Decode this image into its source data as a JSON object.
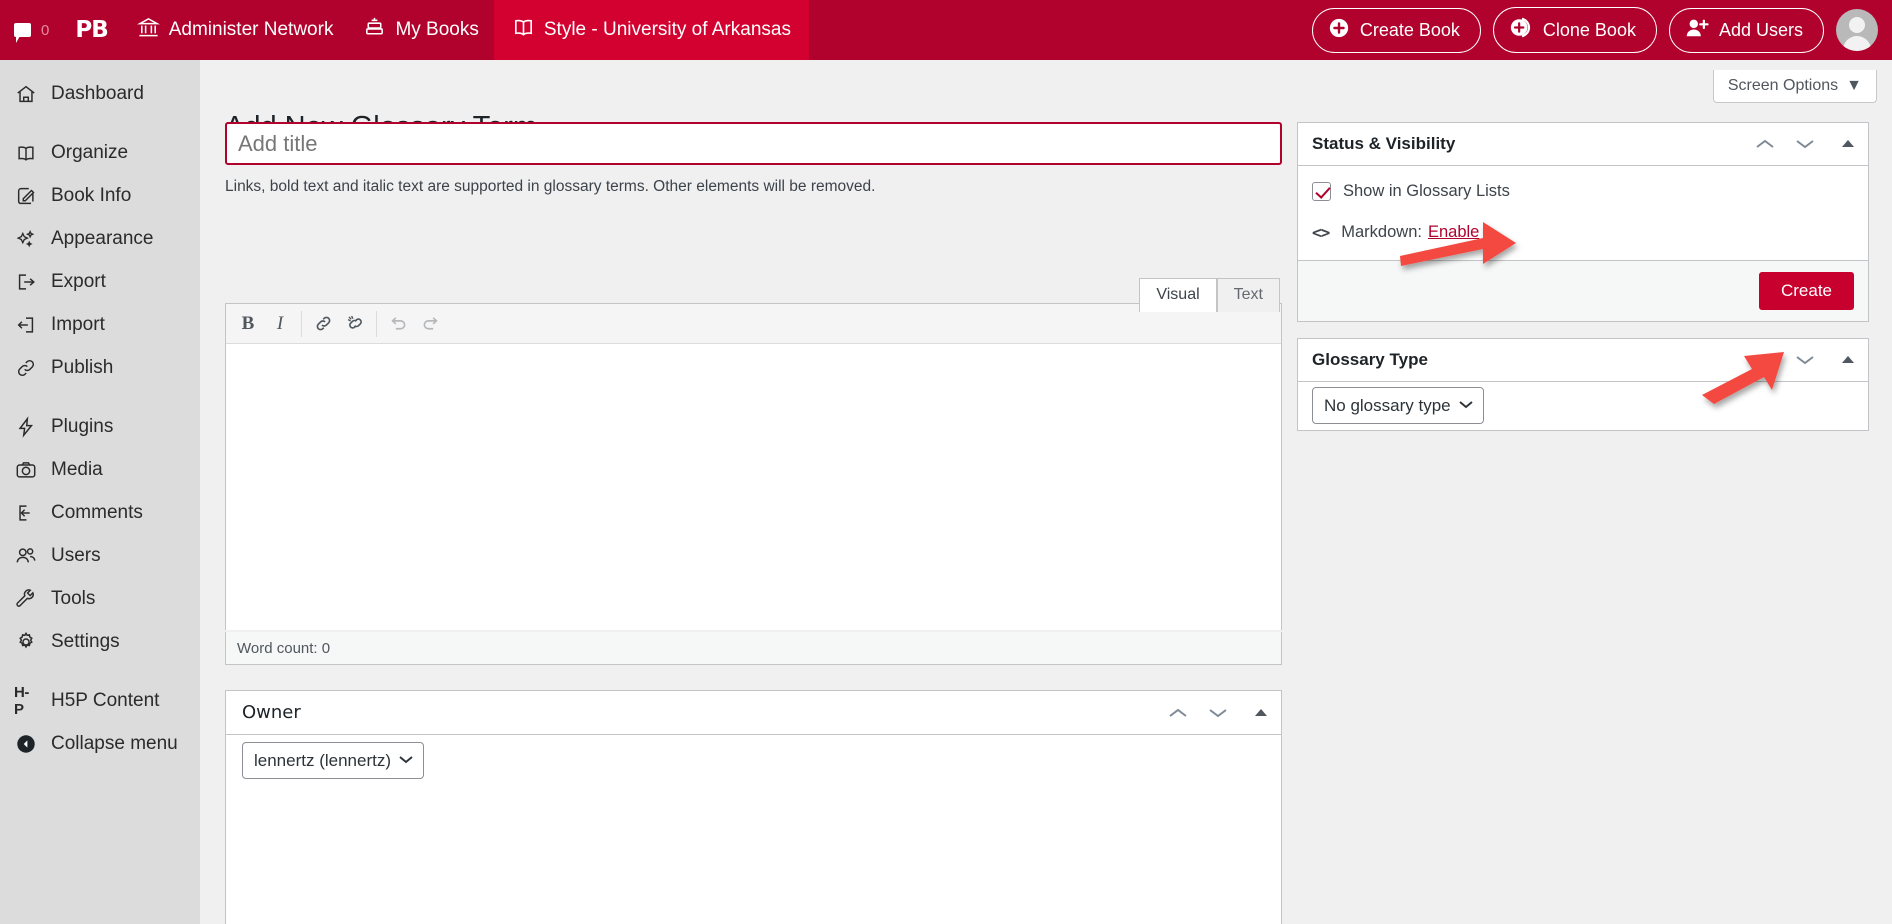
{
  "adminbar": {
    "comment_count": "0",
    "comment_icon": "comment-bubble-icon",
    "logo_text": "PB",
    "items": [
      {
        "label": "Administer Network",
        "icon": "bank-icon"
      },
      {
        "label": "My Books",
        "icon": "books-icon"
      },
      {
        "label": "Style - University of Arkansas",
        "icon": "open-book-icon"
      }
    ],
    "buttons": [
      {
        "label": "Create Book",
        "icon": "plus-circle-icon"
      },
      {
        "label": "Clone Book",
        "icon": "clone-circle-icon"
      },
      {
        "label": "Add Users",
        "icon": "user-plus-icon"
      }
    ],
    "avatar_alt": "User avatar",
    "bg_color": "#b0022c",
    "highlight_color": "#d2012f"
  },
  "sidebar": {
    "items": [
      {
        "label": "Dashboard",
        "icon": "home-icon"
      },
      {
        "label": "Organize",
        "icon": "open-book-icon"
      },
      {
        "label": "Book Info",
        "icon": "edit-square-icon"
      },
      {
        "label": "Appearance",
        "icon": "sparkles-icon"
      },
      {
        "label": "Export",
        "icon": "export-arrow-icon"
      },
      {
        "label": "Import",
        "icon": "import-arrow-icon"
      },
      {
        "label": "Publish",
        "icon": "link-chain-icon"
      },
      {
        "label": "Plugins",
        "icon": "plug-bolt-icon"
      },
      {
        "label": "Media",
        "icon": "camera-icon"
      },
      {
        "label": "Comments",
        "icon": "comment-icon"
      },
      {
        "label": "Users",
        "icon": "users-icon"
      },
      {
        "label": "Tools",
        "icon": "wrench-icon"
      },
      {
        "label": "Settings",
        "icon": "gear-icon"
      }
    ],
    "h5p": {
      "label": "H5P Content",
      "mark": "H-P",
      "icon": "h5p-icon"
    },
    "collapse": {
      "label": "Collapse menu",
      "icon": "collapse-left-icon"
    }
  },
  "screen_options": {
    "label": "Screen Options",
    "icon": "chevron-down-icon"
  },
  "page": {
    "title": "Add New Glossary Term",
    "title_input_placeholder": "Add title",
    "title_input_value": "",
    "help_text": "Links, bold text and italic text are supported in glossary terms. Other elements will be removed."
  },
  "editor": {
    "tabs": [
      {
        "label": "Visual",
        "active": true
      },
      {
        "label": "Text",
        "active": false
      }
    ],
    "toolbar": [
      {
        "name": "bold-button",
        "label": "B",
        "disabled": false
      },
      {
        "name": "italic-button",
        "label": "I",
        "disabled": false
      },
      {
        "name": "insert-link-button",
        "label": "",
        "disabled": false
      },
      {
        "name": "remove-link-button",
        "label": "",
        "disabled": false
      },
      {
        "name": "undo-button",
        "label": "",
        "disabled": true
      },
      {
        "name": "redo-button",
        "label": "",
        "disabled": true
      }
    ],
    "content": "",
    "word_count": "Word count: 0"
  },
  "owner_box": {
    "title": "Owner",
    "select_value": "lennertz (lennertz)"
  },
  "status_visibility": {
    "title": "Status & Visibility",
    "checkbox_label": "Show in Glossary Lists",
    "checkbox_checked": true,
    "markdown_label": "Markdown:",
    "markdown_link": "Enable",
    "markdown_icon": "code-brackets-icon",
    "create_button": "Create"
  },
  "glossary_type": {
    "title": "Glossary Type",
    "select_value": "No glossary type"
  },
  "annotations": {
    "arrow_color": "#f4483f",
    "arrow1_name": "arrow-to-show-in-glossary-lists",
    "arrow2_name": "arrow-to-create-button"
  }
}
